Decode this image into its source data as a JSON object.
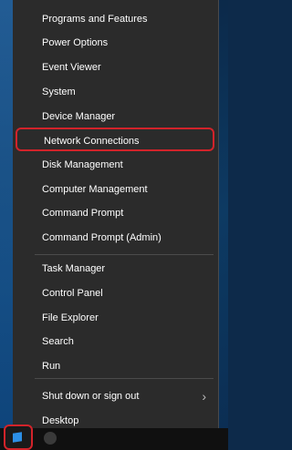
{
  "menu": {
    "items": [
      {
        "label": "Programs and Features"
      },
      {
        "label": "Power Options"
      },
      {
        "label": "Event Viewer"
      },
      {
        "label": "System"
      },
      {
        "label": "Device Manager"
      },
      {
        "label": "Network Connections"
      },
      {
        "label": "Disk Management"
      },
      {
        "label": "Computer Management"
      },
      {
        "label": "Command Prompt"
      },
      {
        "label": "Command Prompt (Admin)"
      },
      {
        "label": "Task Manager"
      },
      {
        "label": "Control Panel"
      },
      {
        "label": "File Explorer"
      },
      {
        "label": "Search"
      },
      {
        "label": "Run"
      },
      {
        "label": "Shut down or sign out"
      },
      {
        "label": "Desktop"
      }
    ],
    "submenu_arrow": "›",
    "highlighted_item": "Network Connections"
  },
  "taskbar": {
    "start_button_icon": "windows-logo-icon",
    "search_icon": "search-bubble-icon"
  },
  "colors": {
    "menu_background": "#2b2b2b",
    "highlight_border": "#d2232a",
    "text": "#ffffff"
  }
}
